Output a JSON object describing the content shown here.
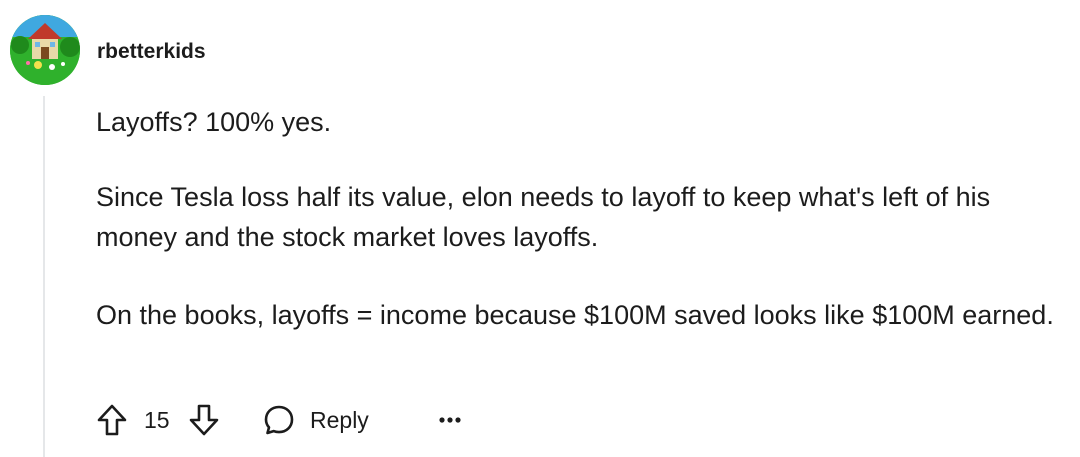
{
  "comment": {
    "author": "rbetterkids",
    "paragraphs": [
      "Layoffs? 100% yes.",
      "Since Tesla loss half its value, elon needs to layoff to keep what's left of his money and the stock market loves layoffs.",
      "On the books, layoffs = income because $100M saved looks like $100M earned."
    ],
    "score": "15",
    "reply_label": "Reply",
    "more_label": "•••"
  },
  "icons": {
    "upvote": "upvote-arrow-icon",
    "downvote": "downvote-arrow-icon",
    "reply": "speech-bubble-icon",
    "more": "ellipsis-icon"
  },
  "colors": {
    "avatar_bg": "#2fb12c",
    "text": "#1c1c1c",
    "thread_line": "#e5e7e9"
  }
}
